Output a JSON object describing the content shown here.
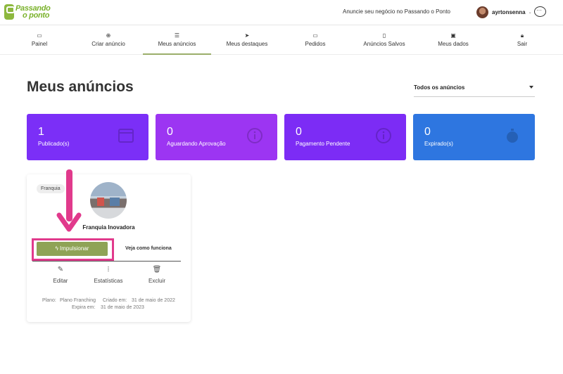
{
  "brand": {
    "line1": "Passando",
    "line2": "o ponto",
    "color": "#7ab22b"
  },
  "header": {
    "announce_link": "Anuncie seu negócio no Passando o Ponto",
    "username": "ayrtonsenna",
    "chat_icon": "chat-bubble-icon"
  },
  "nav": {
    "items": [
      {
        "label": "Painel",
        "icon": "laptop-icon"
      },
      {
        "label": "Criar anúncio",
        "icon": "plus-circle-icon"
      },
      {
        "label": "Meus anúncios",
        "icon": "list-icon",
        "active": true
      },
      {
        "label": "Meus destaques",
        "icon": "rocket-icon"
      },
      {
        "label": "Pedidos",
        "icon": "monitor-icon"
      },
      {
        "label": "Anúncios Salvos",
        "icon": "bookmark-icon"
      },
      {
        "label": "Meus dados",
        "icon": "id-card-icon"
      },
      {
        "label": "Sair",
        "icon": "lock-icon"
      }
    ]
  },
  "page": {
    "title": "Meus anúncios",
    "filter_value": "Todos os anúncios"
  },
  "stats": [
    {
      "count": "1",
      "label": "Publicado(s)",
      "color": "#7b2ff7",
      "icon": "browser-icon"
    },
    {
      "count": "0",
      "label": "Aguardando Aprovação",
      "color": "#9c35f2",
      "icon": "info-icon"
    },
    {
      "count": "0",
      "label": "Pagamento Pendente",
      "color": "#7c2cf5",
      "icon": "info-icon"
    },
    {
      "count": "0",
      "label": "Expirado(s)",
      "color": "#2e76e0",
      "icon": "stopwatch-icon"
    }
  ],
  "listing": {
    "category": "Franquia",
    "name": "Franquia Inovadora",
    "boost_label": "Impulsionar",
    "how_label": "Veja como funciona",
    "edit_label": "Editar",
    "stats_label": "Estatísticas",
    "delete_label": "Excluir",
    "plan_label": "Plano:",
    "plan_value": "Plano Franching",
    "created_label": "Criado em:",
    "created_value": "31 de maio de 2022",
    "expires_label": "Expira em:",
    "expires_value": "31 de maio de 2023"
  },
  "annotation_color": "#e13a8c",
  "accent_green": "#8fa356"
}
